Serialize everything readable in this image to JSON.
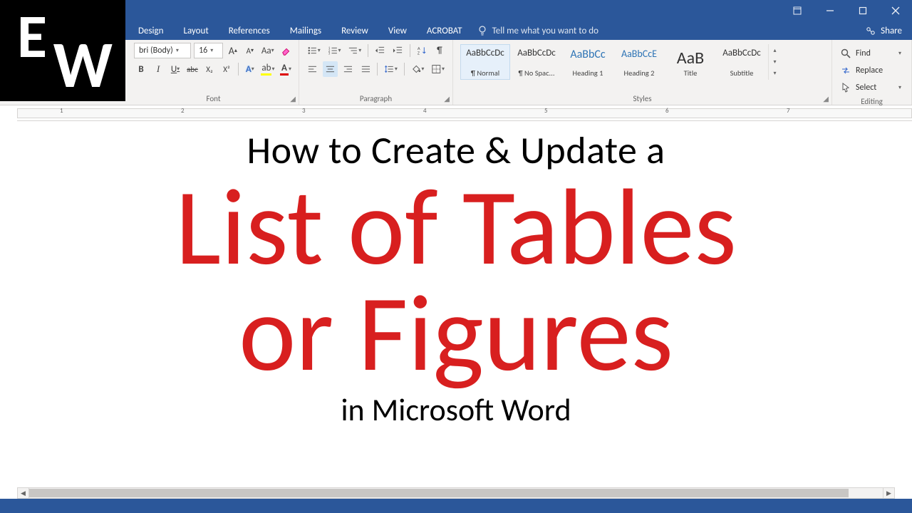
{
  "menu": {
    "tabs": [
      "Design",
      "Layout",
      "References",
      "Mailings",
      "Review",
      "View",
      "ACROBAT"
    ],
    "tell": "Tell me what you want to do",
    "share": "Share"
  },
  "font": {
    "name": "bri (Body)",
    "size": "16",
    "group_label": "Font",
    "increase": "A",
    "decrease": "A",
    "case": "Aa",
    "bold": "B",
    "italic": "I",
    "underline": "U",
    "strike": "abc",
    "sub": "X₂",
    "sup": "X²"
  },
  "paragraph": {
    "group_label": "Paragraph",
    "pilcrow": "¶"
  },
  "styles": {
    "group_label": "Styles",
    "items": [
      {
        "sample": "AaBbCcDc",
        "name": "¶ Normal",
        "cls": "",
        "sel": true,
        "size": "13px"
      },
      {
        "sample": "AaBbCcDc",
        "name": "¶ No Spac...",
        "cls": "",
        "sel": false,
        "size": "13px"
      },
      {
        "sample": "AaBbCc",
        "name": "Heading 1",
        "cls": "blue",
        "sel": false,
        "size": "16px"
      },
      {
        "sample": "AaBbCcE",
        "name": "Heading 2",
        "cls": "blue",
        "sel": false,
        "size": "14px"
      },
      {
        "sample": "AaB",
        "name": "Title",
        "cls": "",
        "sel": false,
        "size": "24px"
      },
      {
        "sample": "AaBbCcDc",
        "name": "Subtitle",
        "cls": "",
        "sel": false,
        "size": "13px"
      }
    ]
  },
  "editing": {
    "group_label": "Editing",
    "find": "Find",
    "replace": "Replace",
    "select": "Select"
  },
  "doc": {
    "l1": "How to Create & Update a",
    "l2": "List of Tables",
    "l3": "or Figures",
    "l4": "in Microsoft Word"
  },
  "ruler": [
    "1",
    "2",
    "3",
    "4",
    "5",
    "6",
    "7"
  ],
  "logo": {
    "e": "E",
    "w": "W"
  }
}
